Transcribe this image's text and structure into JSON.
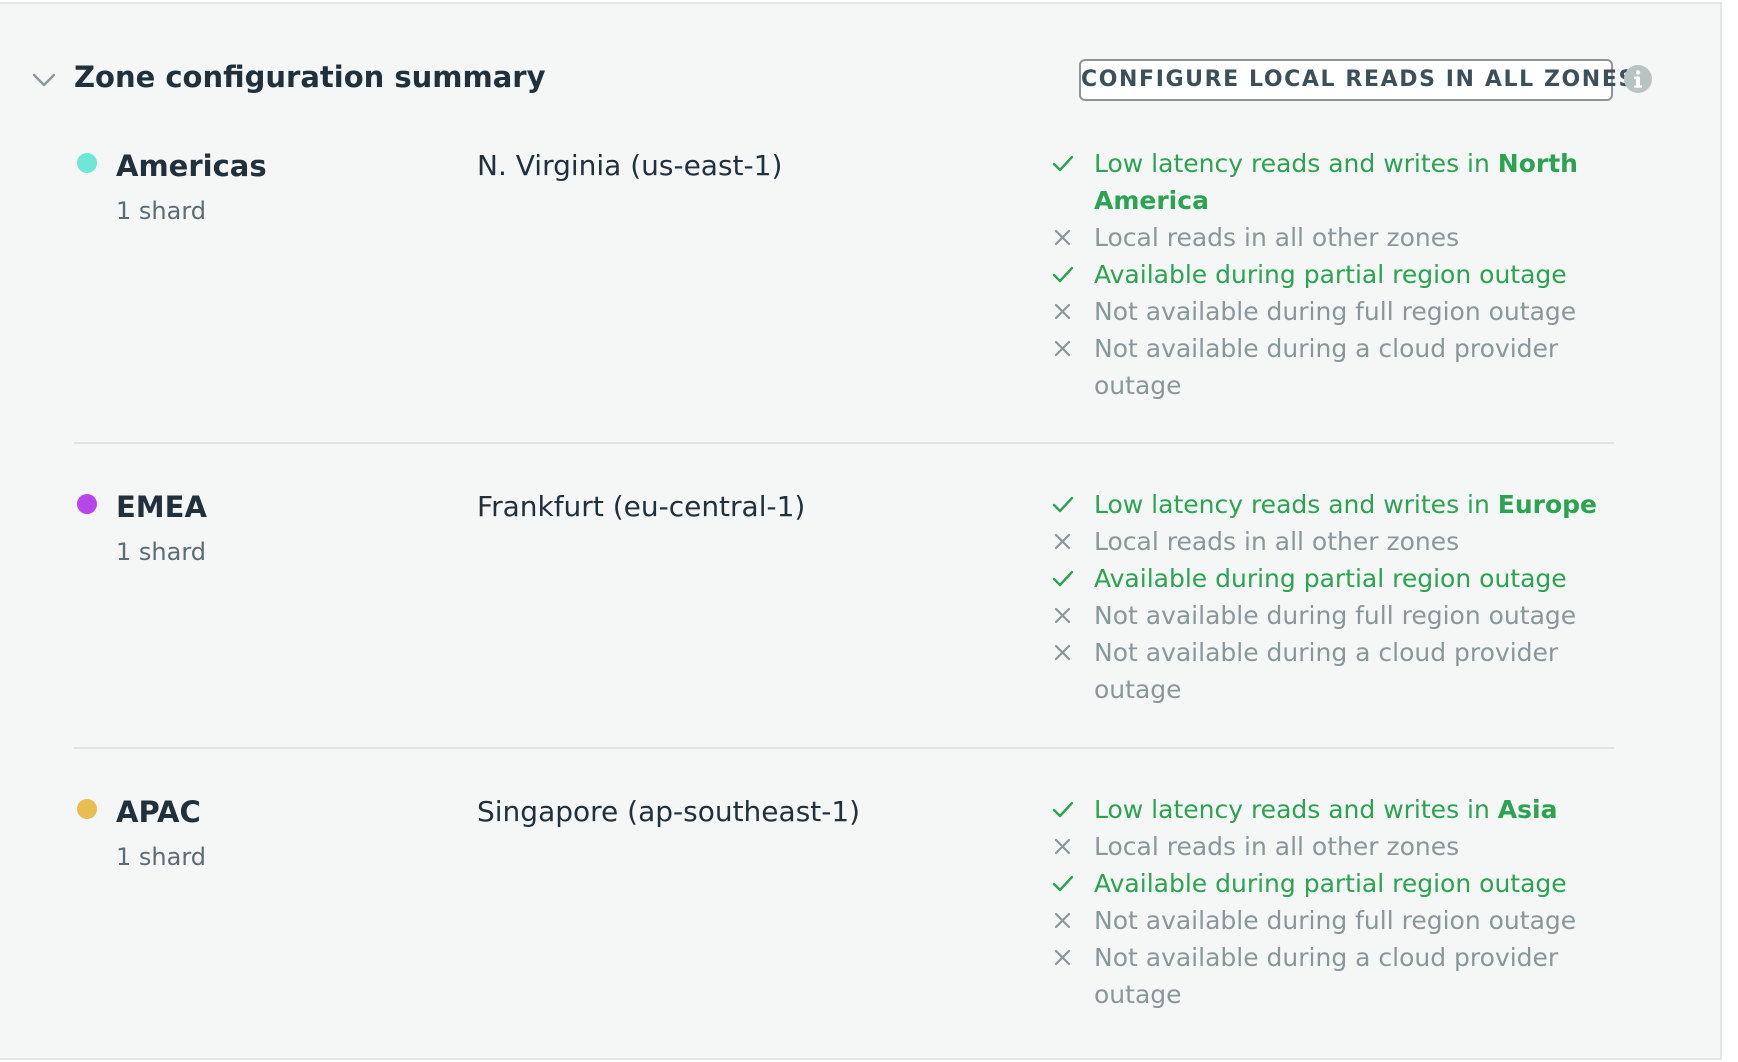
{
  "header": {
    "title": "Zone configuration summary",
    "configure_button": "CONFIGURE LOCAL READS IN ALL ZONES"
  },
  "icons": {
    "collapse": "chevron-down-icon",
    "info": "info-icon",
    "positive": "check-icon",
    "negative": "x-icon"
  },
  "colors": {
    "positive": "#2ba351",
    "negative": "#89979b",
    "americas": "#6ee7d6",
    "emea": "#b646e8",
    "apac": "#e8bd52"
  },
  "zones": [
    {
      "name": "Americas",
      "shards": "1 shard",
      "region": "N. Virginia (us-east-1)",
      "color": "#6ee7d6",
      "features": [
        {
          "ok": true,
          "text": "Low latency reads and writes in ",
          "highlight": "North America"
        },
        {
          "ok": false,
          "text": "Local reads in all other zones"
        },
        {
          "ok": true,
          "text": "Available during partial region outage"
        },
        {
          "ok": false,
          "text": "Not available during full region outage"
        },
        {
          "ok": false,
          "text": "Not available during a cloud provider outage"
        }
      ]
    },
    {
      "name": "EMEA",
      "shards": "1 shard",
      "region": "Frankfurt (eu-central-1)",
      "color": "#b646e8",
      "features": [
        {
          "ok": true,
          "text": "Low latency reads and writes in ",
          "highlight": "Europe"
        },
        {
          "ok": false,
          "text": "Local reads in all other zones"
        },
        {
          "ok": true,
          "text": "Available during partial region outage"
        },
        {
          "ok": false,
          "text": "Not available during full region outage"
        },
        {
          "ok": false,
          "text": "Not available during a cloud provider outage"
        }
      ]
    },
    {
      "name": "APAC",
      "shards": "1 shard",
      "region": "Singapore (ap-southeast-1)",
      "color": "#e8bd52",
      "features": [
        {
          "ok": true,
          "text": "Low latency reads and writes in ",
          "highlight": "Asia"
        },
        {
          "ok": false,
          "text": "Local reads in all other zones"
        },
        {
          "ok": true,
          "text": "Available during partial region outage"
        },
        {
          "ok": false,
          "text": "Not available during full region outage"
        },
        {
          "ok": false,
          "text": "Not available during a cloud provider outage"
        }
      ]
    }
  ]
}
